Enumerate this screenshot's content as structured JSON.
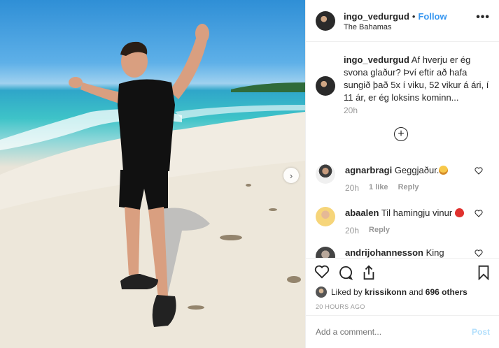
{
  "post": {
    "author": "ingo_vedurgud",
    "follow_label": "Follow",
    "location": "The Bahamas",
    "more_label": "•••",
    "photo_alt": "Man in black t-shirt and shorts giving thumbs up on a sandy beach"
  },
  "caption": {
    "username": "ingo_vedurgud",
    "text": "Af hverju er ég svona glaður? Því eftir að hafa sungið það 5x í viku, 52 vikur á ári, í 11 ár, er ég loksins kominn...",
    "time": "20h",
    "load_more_icon": "plus-circle-icon"
  },
  "comments": [
    {
      "username": "agnarbragi",
      "text": "Geggjaður.",
      "emoji": "grinning-emoji",
      "time": "20h",
      "likes": "1 like",
      "reply": "Reply"
    },
    {
      "username": "abaalen",
      "text": "Til hamingju vinur",
      "emoji": "balloon-emoji",
      "time": "20h",
      "likes": "",
      "reply": "Reply"
    },
    {
      "username": "andrijohannesson",
      "text": "King",
      "emoji": "",
      "time": "",
      "likes": "",
      "reply": ""
    }
  ],
  "actions": {
    "icons": [
      "heart-icon",
      "comment-icon",
      "share-icon",
      "bookmark-icon"
    ]
  },
  "likes": {
    "prefix": "Liked by",
    "user": "krissikonn",
    "and": "and",
    "others": "696 others"
  },
  "timestamp": "20 HOURS AGO",
  "composer": {
    "placeholder": "Add a comment...",
    "post_label": "Post"
  },
  "colors": {
    "link_blue": "#3897f0",
    "post_disabled": "#b2dffc",
    "muted": "#999999"
  }
}
